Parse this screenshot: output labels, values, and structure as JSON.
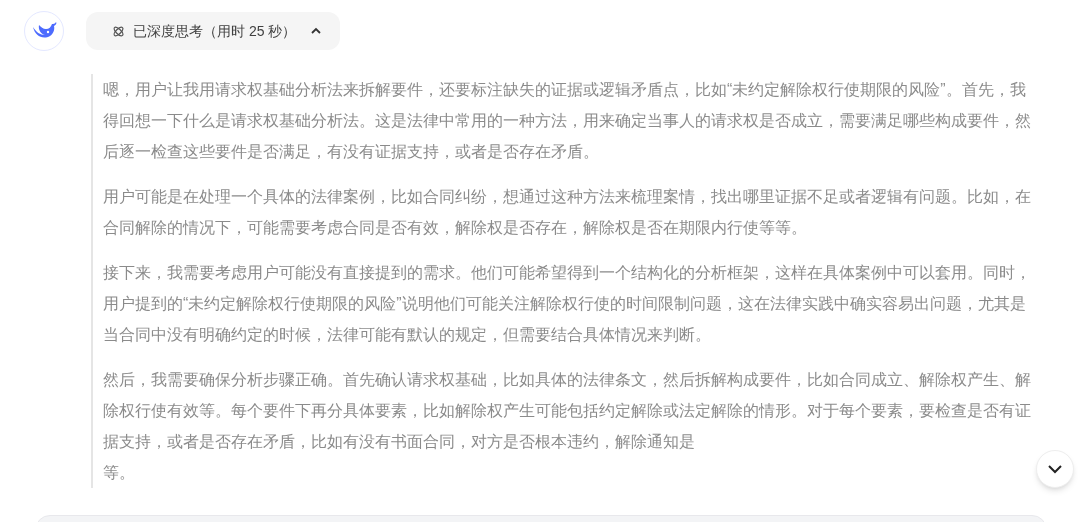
{
  "thinking_toggle": {
    "label": "已深度思考（用时 25 秒）",
    "expanded": true
  },
  "thoughts": [
    {
      "text": "嗯，用户让我用请求权基础分析法来拆解要件，还要标注缺失的证据或逻辑矛盾点，比如“未约定解除权行使期限的风险”。首先，我得回想一下什么是请求权基础分析法。这是法律中常用的一种方法，用来确定当事人的请求权是否成立，需要满足哪些构成要件，然后逐一检查这些要件是否满足，有没有证据支持，或者是否存在矛盾。"
    },
    {
      "text": "用户可能是在处理一个具体的法律案例，比如合同纠纷，想通过这种方法来梳理案情，找出哪里证据不足或者逻辑有问题。比如，在合同解除的情况下，可能需要考虑合同是否有效，解除权是否存在，解除权是否在期限内行使等等。"
    },
    {
      "text": "接下来，我需要考虑用户可能没有直接提到的需求。他们可能希望得到一个结构化的分析框架，这样在具体案例中可以套用。同时，用户提到的“未约定解除权行使期限的风险”说明他们可能关注解除权行使的时间限制问题，这在法律实践中确实容易出问题，尤其是当合同中没有明确约定的时候，法律可能有默认的规定，但需要结合具体情况来判断。"
    },
    {
      "text": "然后，我需要确保分析步骤正确。首先确认请求权基础，比如具体的法律条文，然后拆解构成要件，比如合同成立、解除权产生、解除权行使有效等。每个要件下再分具体要素，比如解除权产生可能包括约定解除或法定解除的情形。对于每个要素，要检查是否有证据支持，或者是否存在矛盾，比如有没有书面合同，对方是否根本违约，解除通知是",
      "tail": "等。"
    }
  ]
}
